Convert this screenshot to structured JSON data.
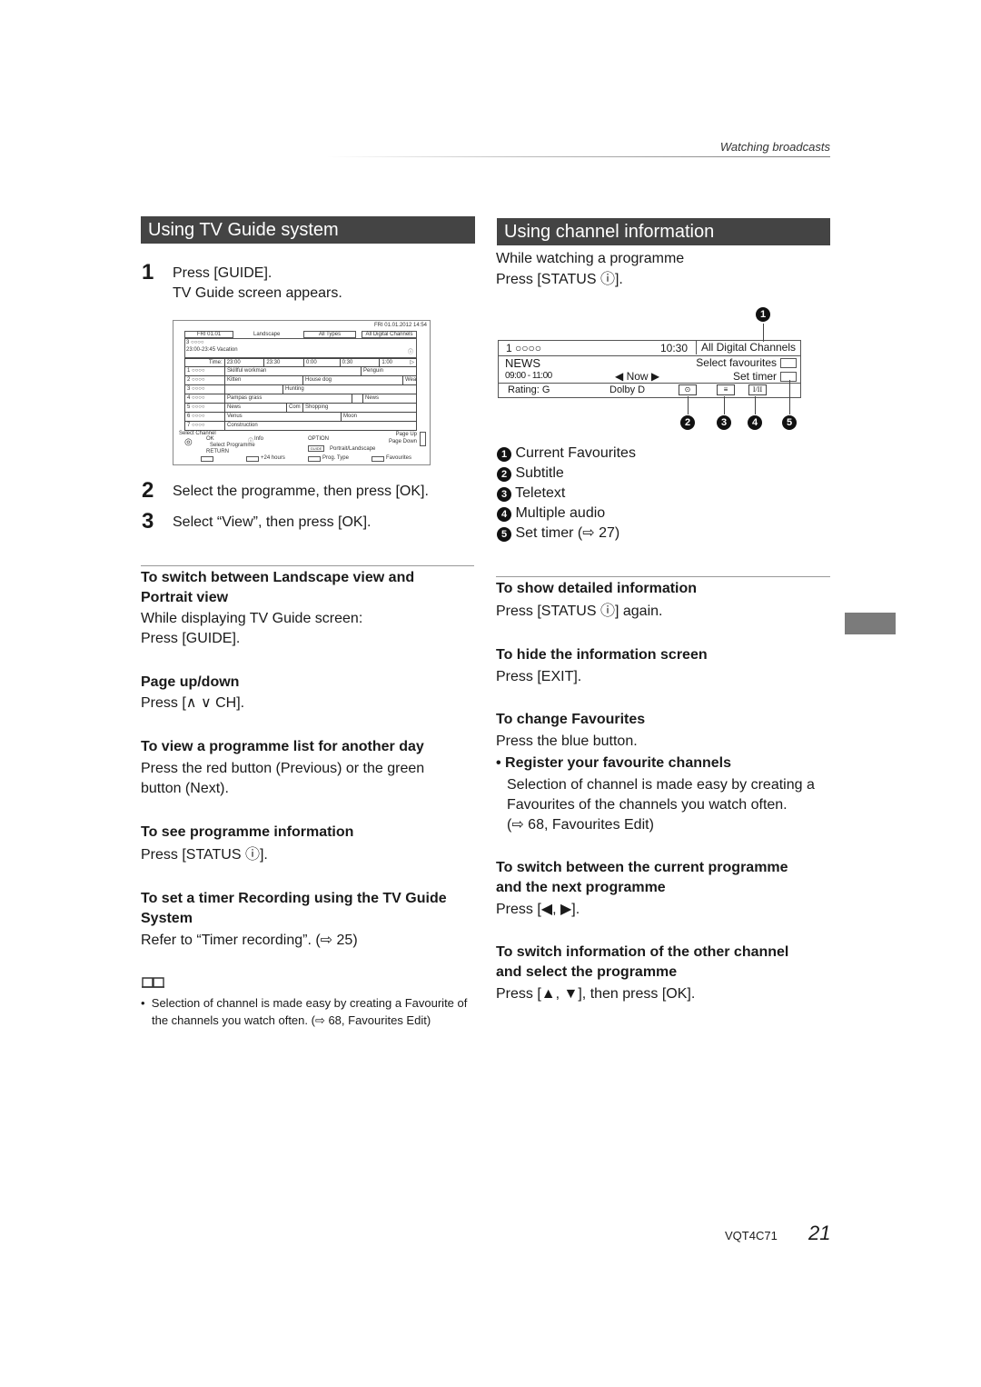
{
  "header": {
    "section": "Watching broadcasts"
  },
  "left": {
    "title": "Using TV Guide system",
    "steps": [
      {
        "num": "1",
        "lines": [
          "Press [GUIDE].",
          "TV Guide screen appears."
        ]
      },
      {
        "num": "2",
        "lines": [
          "Select the programme, then press [OK]."
        ]
      },
      {
        "num": "3",
        "lines": [
          "Select “View”, then press [OK]."
        ]
      }
    ],
    "guide_screen": {
      "datetime": "FRI 01.01.2012 14:54",
      "tab_date": "FRI 01.01",
      "tab_view": "Landscape",
      "filter_type": "All Types",
      "filter_channels": "All Digital Channels",
      "selected_channel": "3 ○○○○",
      "selected_programme": "23:00-23:45  Vacation",
      "time_label": "Time:",
      "times": [
        "23:00",
        "23:30",
        "0:00",
        "0:30",
        "1:00"
      ],
      "rows": [
        {
          "ch": "1 ○○○○",
          "cells": [
            "Skillful workman",
            "Penguin"
          ]
        },
        {
          "ch": "2 ○○○○",
          "cells": [
            "Kitten",
            "House dog",
            "Wea"
          ]
        },
        {
          "ch": "3 ○○○○",
          "cells": [
            "",
            "Hunting"
          ]
        },
        {
          "ch": "4 ○○○○",
          "cells": [
            "Pampas grass",
            "",
            "News"
          ]
        },
        {
          "ch": "5 ○○○○",
          "cells": [
            "News",
            "Com",
            "Shopping"
          ]
        },
        {
          "ch": "6 ○○○○",
          "cells": [
            "Venus",
            "Moon"
          ]
        },
        {
          "ch": "7 ○○○○",
          "cells": [
            "Construction"
          ]
        }
      ],
      "legend": {
        "select_channel": "Select Channel",
        "ok": "OK",
        "select_programme": "Select Programme",
        "return": "RETURN",
        "info": "Info",
        "option": "OPTION",
        "guide_key": "GUIDE",
        "portrait_landscape": "Portrait/Landscape",
        "page_up": "Page Up",
        "page_down": "Page Down",
        "plus24": "+24 hours",
        "prog_type": "Prog. Type",
        "favourites": "Favourites"
      }
    },
    "sections": [
      {
        "heading": "To switch between Landscape view and Portrait view",
        "body": [
          "While displaying TV Guide screen:",
          "Press [GUIDE]."
        ]
      },
      {
        "heading": "Page up/down",
        "body": [
          "Press [∧  ∨ CH]."
        ]
      },
      {
        "heading": "To view a programme list for another day",
        "body": [
          "Press the red button (Previous) or the green button (Next)."
        ]
      },
      {
        "heading": "To see programme information",
        "body": [
          "Press [STATUS ⓘ]."
        ]
      },
      {
        "heading": "To set a timer Recording using the TV Guide System",
        "body": [
          "Refer to “Timer recording”. (⇨ 25)"
        ]
      }
    ],
    "note": "Selection of channel is made easy by creating a Favourite of the channels you watch often. (⇨ 68, Favourites Edit)"
  },
  "right": {
    "title": "Using channel information",
    "intro": [
      "While watching a programme",
      "Press [STATUS ⓘ]."
    ],
    "info_panel": {
      "channel": "1 ○○○○",
      "time": "10:30",
      "favourites": "All Digital Channels",
      "programme": "NEWS",
      "programme_time": "09:00 - 11:00",
      "now": "◀ Now ▶",
      "select_favourites": "Select favourites",
      "set_timer": "Set timer",
      "rating": "Rating: G",
      "audio": "Dolby D",
      "icon4": "I/II"
    },
    "callouts": [
      {
        "num": "1",
        "label": "Current Favourites"
      },
      {
        "num": "2",
        "label": "Subtitle"
      },
      {
        "num": "3",
        "label": "Teletext"
      },
      {
        "num": "4",
        "label": "Multiple audio"
      },
      {
        "num": "5",
        "label": "Set timer (⇨ 27)"
      }
    ],
    "sections": [
      {
        "heading": "To show detailed information",
        "body": [
          "Press [STATUS ⓘ] again."
        ]
      },
      {
        "heading": "To hide the information screen",
        "body": [
          "Press [EXIT]."
        ]
      },
      {
        "heading": "To change Favourites",
        "body": [
          "Press the blue button."
        ]
      }
    ],
    "register": {
      "heading": "• Register your favourite channels",
      "body": [
        "Selection of channel is made easy by creating a",
        "Favourites of the channels you watch often.",
        "(⇨ 68, Favourites Edit)"
      ]
    },
    "sections2": [
      {
        "heading": "To switch between the current programme and the next programme",
        "body": [
          "Press [◀, ▶]."
        ]
      },
      {
        "heading": "To switch information of the other channel and select the programme",
        "body": [
          "Press [▲, ▼], then press [OK]."
        ]
      }
    ]
  },
  "footer": {
    "code": "VQT4C71",
    "page": "21"
  }
}
